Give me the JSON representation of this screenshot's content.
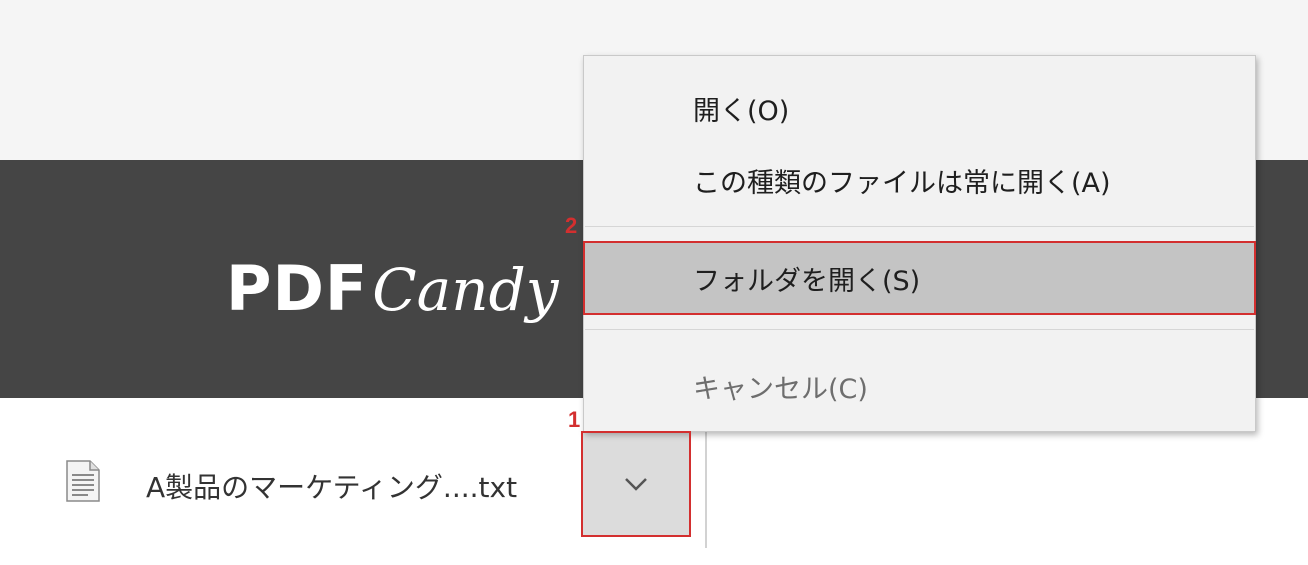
{
  "brand": {
    "logo_bold": "PDF",
    "logo_script": "Candy"
  },
  "download": {
    "file_name": "A製品のマーケティング....txt",
    "file_icon": "text-file-icon",
    "options_icon": "chevron-down-icon"
  },
  "context_menu": {
    "items": [
      {
        "label": "開く(O)"
      },
      {
        "label": "この種類のファイルは常に開く(A)"
      },
      {
        "label": "フォルダを開く(S)",
        "highlighted": true
      },
      {
        "label": "キャンセル(C)"
      }
    ]
  },
  "callouts": [
    {
      "number": "1"
    },
    {
      "number": "2"
    }
  ],
  "colors": {
    "banner": "#454545",
    "highlight": "#c4c4c4",
    "callout": "#d32f2f"
  }
}
